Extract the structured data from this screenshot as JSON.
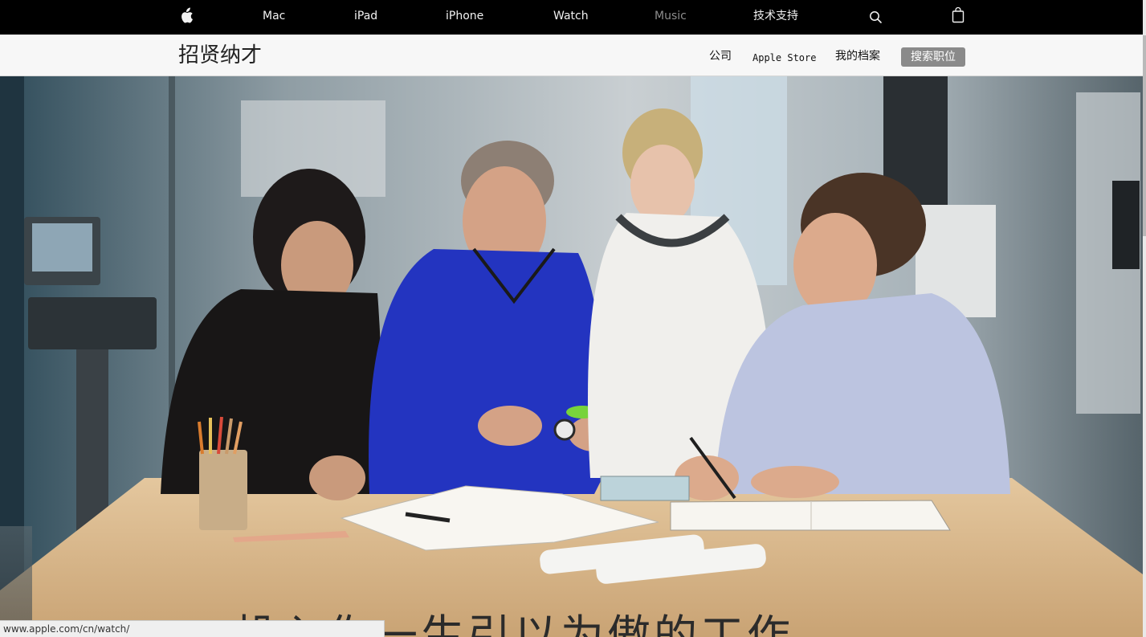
{
  "globalnav": {
    "apple_logo": "apple-logo",
    "items": [
      {
        "label": "Mac"
      },
      {
        "label": "iPad"
      },
      {
        "label": "iPhone"
      },
      {
        "label": "Watch"
      },
      {
        "label": "Music"
      },
      {
        "label": "技术支持"
      }
    ],
    "search_icon": "search-icon",
    "bag_icon": "bag-icon"
  },
  "subnav": {
    "title": "招贤纳才",
    "links": [
      {
        "label": "公司"
      },
      {
        "label": "Apple Store"
      },
      {
        "label": "我的档案"
      }
    ],
    "search_jobs_button": "搜索职位"
  },
  "hero": {
    "image": "four-people-collaborating-at-table",
    "headline": "投入你一生引以为傲的工作"
  },
  "statusbar": {
    "url": "www.apple.com/cn/watch/"
  },
  "colors": {
    "globalnav_bg": "#000000",
    "subnav_bg": "#f7f7f7",
    "search_button_bg": "#8a8a8a"
  }
}
